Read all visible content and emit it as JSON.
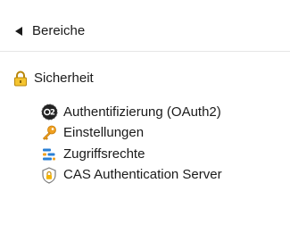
{
  "nav": {
    "back_label": "Bereiche",
    "back_icon": "triangle-left-icon"
  },
  "section": {
    "label": "Sicherheit",
    "icon": "padlock-icon",
    "items": [
      {
        "label": "Authentifizierung (OAuth2)",
        "icon": "oauth2-badge-icon"
      },
      {
        "label": "Einstellungen",
        "icon": "key-icon"
      },
      {
        "label": "Zugriffsrechte",
        "icon": "access-rights-icon"
      },
      {
        "label": "CAS Authentication Server",
        "icon": "shield-lock-icon"
      }
    ]
  },
  "colors": {
    "text": "#1a1a1a",
    "padlock_gold": "#e8a317",
    "key_orange": "#f0a020",
    "access_blue": "#2a7fd4",
    "access_orange": "#f0a020",
    "oauth_dark": "#222222"
  }
}
